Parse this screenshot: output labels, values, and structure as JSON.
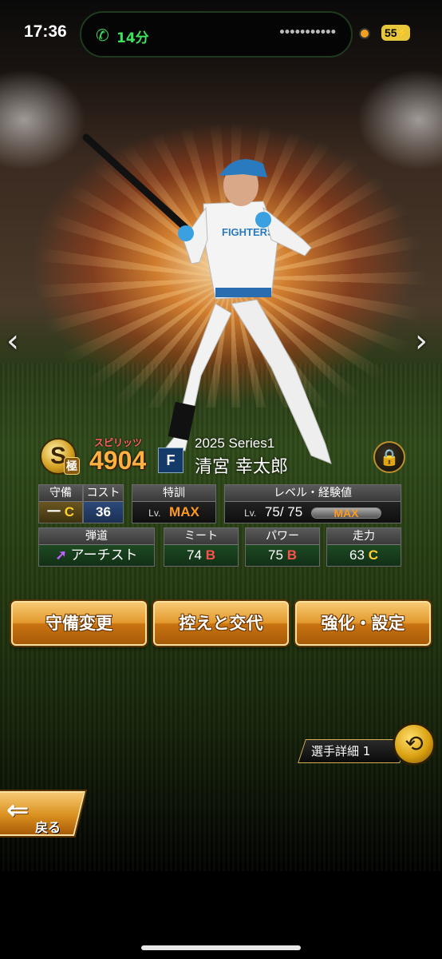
{
  "status_bar": {
    "time": "17:36",
    "call_duration": "14分",
    "call_dots": "•••••••••••",
    "battery": "55"
  },
  "player": {
    "rank_letter": "S",
    "rank_tag": "極",
    "spirits_label": "スピリッツ",
    "spirits_value": "4904",
    "team_logo": "F",
    "series": "2025 Series1",
    "name": "清宮 幸太郎"
  },
  "stats": {
    "defense": {
      "label": "守備",
      "position": "一",
      "grade": "C"
    },
    "cost": {
      "label": "コスト",
      "value": "36"
    },
    "special_training": {
      "label": "特訓",
      "lv": "Lv.",
      "value": "MAX"
    },
    "level_exp": {
      "label": "レベル・経験値",
      "lv": "Lv.",
      "value": "75/ 75",
      "bar_label": "MAX",
      "progress": 1.0
    },
    "trajectory": {
      "label": "弾道",
      "value": "アーチスト"
    },
    "meet": {
      "label": "ミート",
      "value": "74",
      "grade": "B"
    },
    "power": {
      "label": "パワー",
      "value": "75",
      "grade": "B"
    },
    "speed": {
      "label": "走力",
      "value": "63",
      "grade": "C"
    }
  },
  "actions": {
    "defense_change": "守備変更",
    "bench_swap": "控えと交代",
    "enhance_settings": "強化・設定"
  },
  "detail": {
    "label": "選手詳細 1"
  },
  "back": {
    "label": "戻る"
  },
  "icons": {
    "nav_left": "‹",
    "nav_right": "›",
    "lock": "lock-icon",
    "swap": "swap-icon",
    "phone": "phone-icon"
  },
  "colors": {
    "accent_gold": "#e39a2e",
    "grade_b": "#ff5050",
    "grade_c": "#ffd030",
    "max_orange": "#ff9a20",
    "call_green": "#3ee05c"
  }
}
